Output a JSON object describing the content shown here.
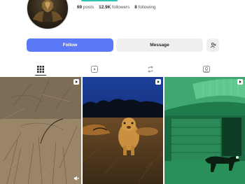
{
  "profile": {
    "stats": [
      {
        "value": "69",
        "label": "posts"
      },
      {
        "value": "12.9K",
        "label": "followers"
      },
      {
        "value": "8",
        "label": "following"
      }
    ]
  },
  "actions": {
    "follow_label": "Follow",
    "message_label": "Message"
  },
  "tabs": [
    {
      "icon": "grid-icon",
      "active": true
    },
    {
      "icon": "reels-icon",
      "active": false
    },
    {
      "icon": "reposts-icon",
      "active": false
    },
    {
      "icon": "tagged-icon",
      "active": false
    }
  ],
  "posts": [
    {
      "scene": "dry-grassland",
      "type": "reel",
      "muted": true
    },
    {
      "scene": "lion-cubs-night",
      "type": "reel",
      "muted": false
    },
    {
      "scene": "night-vision-dog-hangar",
      "type": "reel",
      "muted": false
    }
  ],
  "colors": {
    "follow_button": "#5b78f6",
    "secondary_button": "#efefef",
    "story_ring": "#2ec4b6"
  }
}
